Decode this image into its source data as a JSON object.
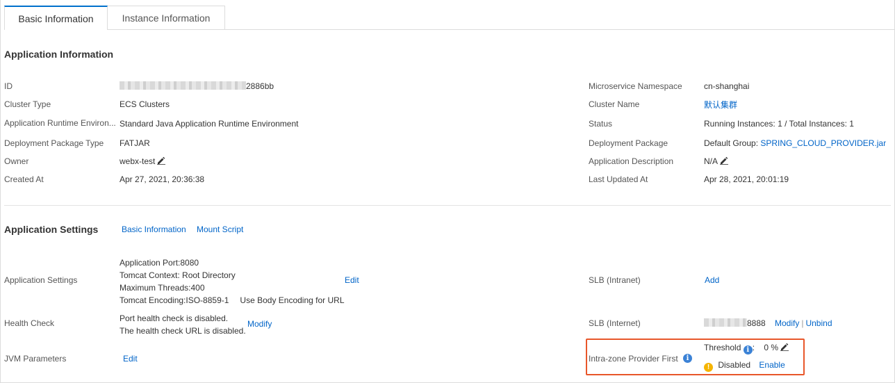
{
  "tabs": [
    {
      "label": "Basic Information",
      "active": true
    },
    {
      "label": "Instance Information",
      "active": false
    }
  ],
  "app_info": {
    "title": "Application Information",
    "left": {
      "id_label": "ID",
      "id_value_suffix": "2886bb",
      "cluster_type_label": "Cluster Type",
      "cluster_type_value": "ECS Clusters",
      "runtime_label": "Application Runtime Environ...",
      "runtime_value": "Standard Java Application Runtime Environment",
      "pkg_type_label": "Deployment Package Type",
      "pkg_type_value": "FATJAR",
      "owner_label": "Owner",
      "owner_value": "webx-test",
      "created_label": "Created At",
      "created_value": "Apr 27, 2021, 20:36:38"
    },
    "right": {
      "namespace_label": "Microservice Namespace",
      "namespace_value": "cn-shanghai",
      "cluster_name_label": "Cluster Name",
      "cluster_name_value": "默认集群",
      "status_label": "Status",
      "status_value": "Running Instances: 1 / Total Instances: 1",
      "pkg_label": "Deployment Package",
      "pkg_group": "Default Group: ",
      "pkg_value": "SPRING_CLOUD_PROVIDER.jar",
      "desc_label": "Application Description",
      "desc_value": "N/A",
      "updated_label": "Last Updated At",
      "updated_value": "Apr 28, 2021, 20:01:19"
    }
  },
  "app_settings": {
    "title": "Application Settings",
    "links": [
      "Basic Information",
      "Mount Script"
    ],
    "settings_label": "Application Settings",
    "settings_lines": [
      "Application Port:8080",
      "Tomcat Context: Root Directory",
      "Maximum Threads:400",
      "Tomcat Encoding:ISO-8859-1"
    ],
    "body_encoding": "Use Body Encoding for URL",
    "settings_edit": "Edit",
    "health_label": "Health Check",
    "health_lines": [
      "Port health check is disabled.",
      "The health check URL is disabled."
    ],
    "health_modify": "Modify",
    "jvm_label": "JVM Parameters",
    "jvm_edit": "Edit",
    "slb_intranet_label": "SLB (Intranet)",
    "slb_intranet_add": "Add",
    "slb_internet_label": "SLB (Internet)",
    "slb_internet_value_suffix": "8888",
    "slb_internet_modify": "Modify",
    "slb_internet_sep": "|",
    "slb_internet_unbind": "Unbind",
    "intrazone_label": "Intra-zone Provider First",
    "threshold_label": "Threshold",
    "threshold_colon": ":",
    "threshold_value": "0 %",
    "status_value": "Disabled",
    "enable_link": "Enable"
  },
  "colors": {
    "link": "#0064c8",
    "highlight": "#e8562a",
    "warning": "#f5b400",
    "info": "#3b82d6"
  }
}
